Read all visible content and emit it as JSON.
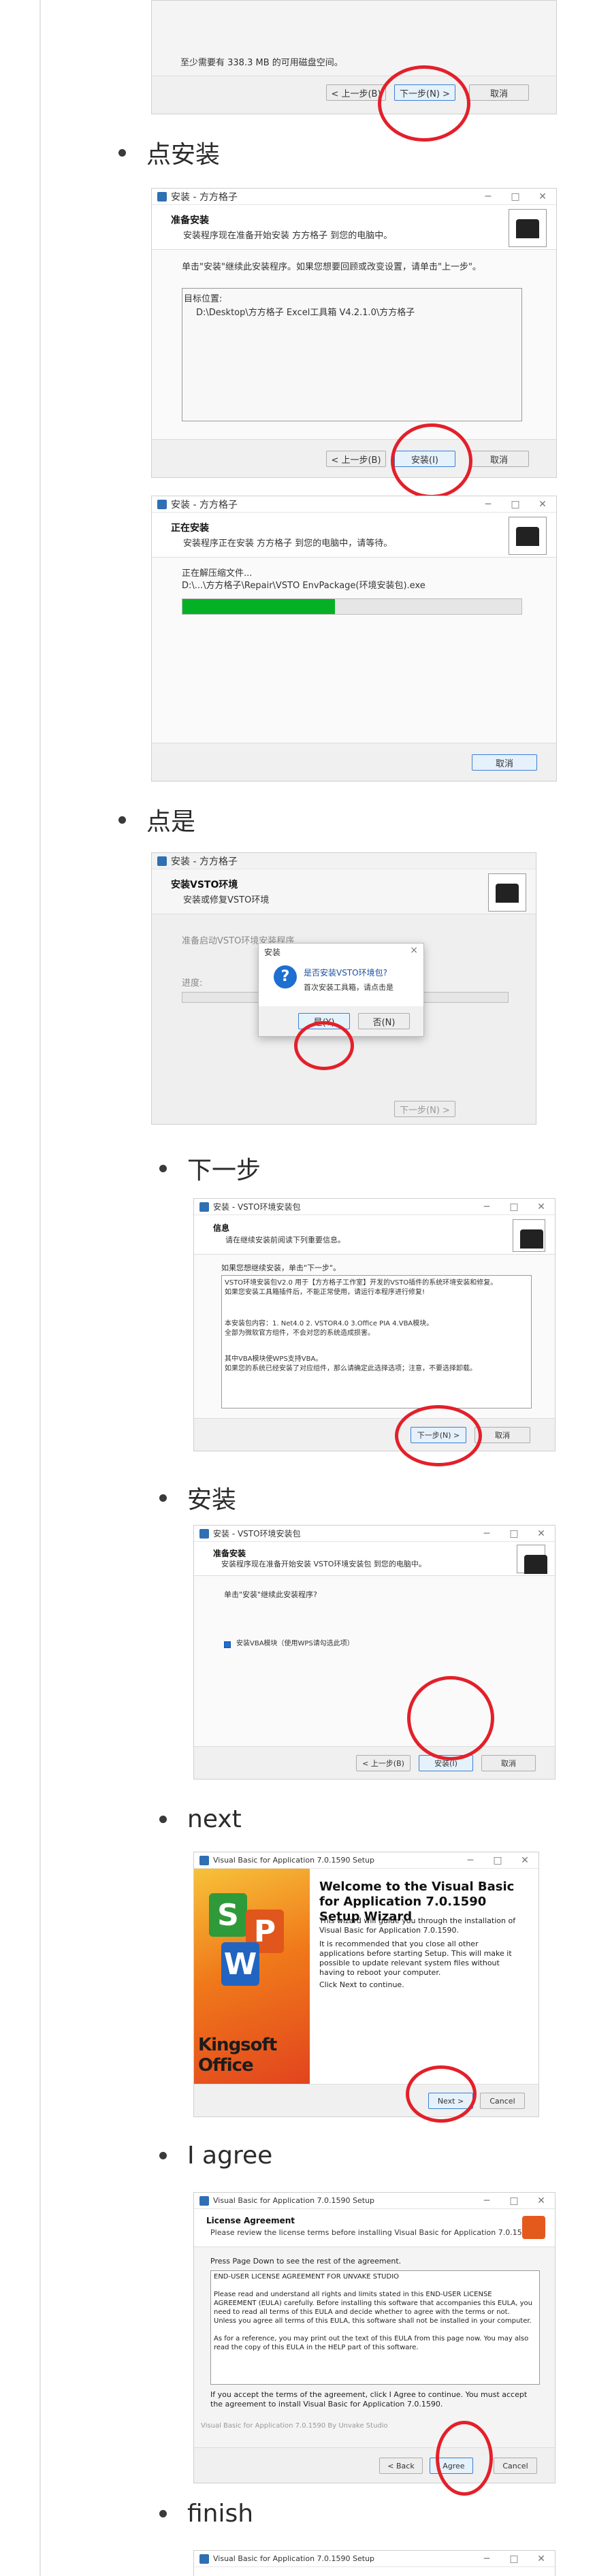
{
  "bullets": {
    "install": "点安装",
    "yes": "点是",
    "next_cn": "下一步",
    "install2": "安装",
    "next_en": "next",
    "agree": "I agree",
    "finish": "finish"
  },
  "shot0": {
    "space_text": "至少需要有 338.3 MB 的可用磁盘空间。",
    "back": "< 上一步(B)",
    "next": "下一步(N) >",
    "cancel": "取消"
  },
  "shot1": {
    "title": "安装 - 方方格子",
    "h1": "准备安装",
    "h2": "安装程序现在准备开始安装 方方格子 到您的电脑中。",
    "text": "单击\"安装\"继续此安装程序。如果您想要回顾或改变设置，请单击\"上一步\"。",
    "target_label": "目标位置:",
    "target_path": "D:\\Desktop\\方方格子 Excel工具箱 V4.2.1.0\\方方格子",
    "back": "< 上一步(B)",
    "install": "安装(I)",
    "cancel": "取消"
  },
  "shot2": {
    "title": "安装 - 方方格子",
    "h1": "正在安装",
    "h2": "安装程序正在安装 方方格子 到您的电脑中，请等待。",
    "line1": "正在解压缩文件...",
    "line2": "D:\\...\\方方格子\\Repair\\VSTO EnvPackage(环境安装包).exe",
    "progress": 0.45,
    "cancel": "取消"
  },
  "shot3": {
    "title": "安装 - 方方格子",
    "h1": "安装VSTO环境",
    "h2": "安装或修复VSTO环境",
    "prep": "准备启动VSTO环境安装程序",
    "progress_label": "进度:",
    "next": "下一步(N) >",
    "dialog_title": "安装",
    "dialog_q": "是否安装VSTO环境包?",
    "dialog_info": "首次安装工具箱，请点击是",
    "yes": "是(Y)",
    "no": "否(N)",
    "close": "×"
  },
  "shot4": {
    "title": "安装 - VSTO环境安装包",
    "h1": "信息",
    "h2": "请在继续安装前阅读下列重要信息。",
    "intro": "如果您想继续安装，单击\"下一步\"。",
    "p1": "VSTO环境安装包V2.0 用于【方方格子工作室】开发的VSTO插件的系统环境安装和修复。\n如果您安装工具箱插件后，不能正常使用，请运行本程序进行修复!",
    "p2": "本安装包内容：1. Net4.0   2. VSTOR4.0   3.Office PIA  4.VBA模块。\n全部为微软官方组件，不会对您的系统造成损害。",
    "p3": "其中VBA模块使WPS支持VBA。\n如果您的系统已经安装了对应组件，那么请确定此选择选项；注意，不要选择卸载。",
    "next": "下一步(N) >",
    "cancel": "取消"
  },
  "shot5": {
    "title": "安装 - VSTO环境安装包",
    "h1": "准备安装",
    "h2": "安装程序现在准备开始安装 VSTO环境安装包 到您的电脑中。",
    "text": "单击\"安装\"继续此安装程序?",
    "checkbox_label": "安装VBA模块（使用WPS请勾选此项）",
    "back": "< 上一步(B)",
    "install": "安装(I)",
    "cancel": "取消"
  },
  "shot6": {
    "title": "Visual Basic for Application 7.0.1590 Setup",
    "welcome": "Welcome to the Visual Basic for Application 7.0.1590 Setup Wizard",
    "p1": "This wizard will guide you through the installation of Visual Basic for Application 7.0.1590.",
    "p2": "It is recommended that you close all other applications before starting Setup. This will make it possible to update relevant system files without having to reboot your computer.",
    "p3": "Click Next to continue.",
    "brand": "Kingsoft Office",
    "next": "Next >",
    "cancel": "Cancel"
  },
  "shot7": {
    "title": "Visual Basic for Application 7.0.1590 Setup",
    "h1": "License Agreement",
    "h2": "Please review the license terms before installing Visual Basic for Application 7.0.1590.",
    "pgdn": "Press Page Down to see the rest of the agreement.",
    "eula": "END-USER LICENSE AGREEMENT FOR UNVAKE STUDIO\n\nPlease read and understand all rights and limits stated in this END-USER LICENSE AGREEMENT (EULA) carefully. Before installing this software that accompanies this EULA, you need to read all terms of this EULA and decide whether to agree with the terms or not. Unless you agree all terms of this EULA, this software shall not be installed in your computer.\n\nAs for a reference, you may print out the text of this EULA from this page now. You may also read the copy of this EULA in the HELP part of this software.",
    "accept": "If you accept the terms of the agreement, click I Agree to continue. You must accept the agreement to install Visual Basic for Application 7.0.1590.",
    "footer": "Visual Basic for Application 7.0.1590 By Unvake Studio",
    "back": "< Back",
    "agree": "I Agree",
    "cancel": "Cancel"
  },
  "shot8": {
    "title": "Visual Basic for Application 7.0.1590 Setup"
  },
  "colors": {
    "ring": "#e3202a",
    "progress": "#06b025"
  }
}
